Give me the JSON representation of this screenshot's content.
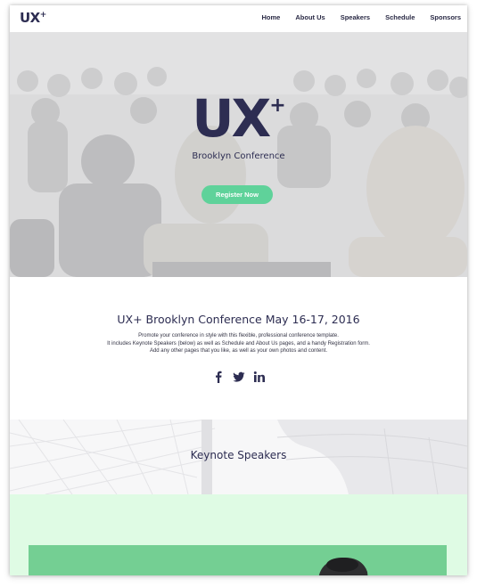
{
  "nav": {
    "logo": "UX",
    "logo_plus": "+",
    "links": [
      "Home",
      "About Us",
      "Speakers",
      "Schedule",
      "Sponsors"
    ]
  },
  "hero": {
    "title": "UX",
    "title_plus": "+",
    "subtitle": "Brooklyn Conference",
    "cta": "Register Now"
  },
  "intro": {
    "title": "UX+ Brooklyn Conference May 16-17, 2016",
    "lines": [
      "Promote your conference in style with this flexible, professional conference template.",
      "It includes Keynote Speakers (below) as well as Schedule and About Us pages, and a handy Registration form.",
      "Add any other pages that you like, as well as your own photos and content."
    ],
    "social": [
      "facebook-icon",
      "twitter-icon",
      "linkedin-icon"
    ]
  },
  "keynote": {
    "title": "Keynote Speakers"
  },
  "colors": {
    "navy": "#2d2d52",
    "accent_green": "#5fd29a",
    "mint_bg": "#dffbe4",
    "card_green": "#74cf93"
  }
}
